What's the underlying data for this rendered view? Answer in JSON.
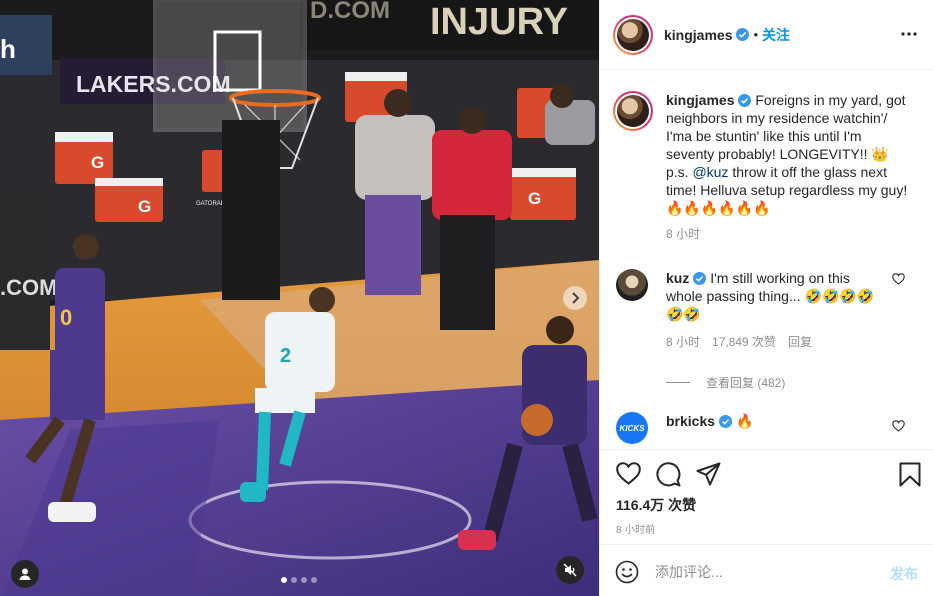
{
  "header": {
    "username": "kingjames",
    "separator": "•",
    "follow_label": "关注"
  },
  "caption": {
    "username": "kingjames",
    "text_1": "Foreigns in my yard, got neighbors in my residence watchin'/ I'ma be stuntin' like this until I'm seventy probably! LONGEVITY!! 👑 p.s. ",
    "mention": "@kuz",
    "text_2": " throw it off the glass next time! Helluva setup regardless my guy! 🔥🔥🔥🔥🔥🔥",
    "time": "8 小时"
  },
  "comments": [
    {
      "username": "kuz",
      "text": "I'm still working on this whole passing thing... 🤣🤣🤣🤣🤣🤣",
      "time": "8 小时",
      "likes": "17,849 次赞",
      "reply_label": "回复",
      "view_replies": "查看回复 (482)"
    },
    {
      "username": "brkicks",
      "avatar_text": "KICKS",
      "text": "🔥"
    }
  ],
  "post": {
    "likes": "116.4万 次赞",
    "posted_time": "8 小时前"
  },
  "add_comment": {
    "placeholder": "添加评论...",
    "post_label": "发布"
  },
  "media": {
    "scene_text": {
      "lakers_sign": "LAKERS.COM",
      "injury_sign": "INJURY",
      "top_sign": "D.COM",
      "side_sign": ".COM",
      "left_edge": "h",
      "cooler_g": "G",
      "jersey_left": "0",
      "jersey_mid": "2",
      "cooler_brand": "GATORADE"
    },
    "carousel": {
      "count": 4,
      "active_index": 0
    }
  },
  "colors": {
    "accent": "#0095f6",
    "verified": "#3897f0",
    "mention": "#00376b",
    "muted": "#8e8e8e"
  },
  "icons": [
    "verified-icon",
    "more-icon",
    "heart-icon",
    "comment-icon",
    "share-icon",
    "bookmark-icon",
    "emoji-icon",
    "user-tag-icon",
    "mute-icon",
    "chevron-right-icon"
  ]
}
